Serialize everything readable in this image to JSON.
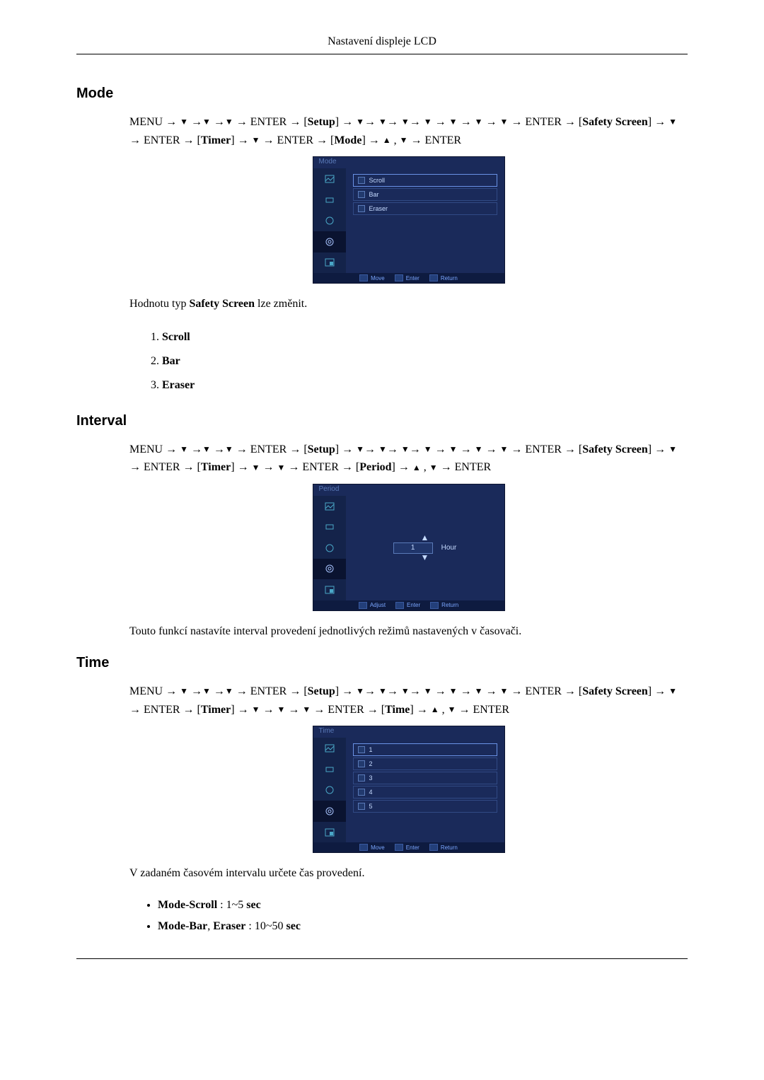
{
  "header": {
    "title": "Nastavení displeje LCD"
  },
  "sections": {
    "mode": {
      "heading": "Mode",
      "nav_a": "MENU → ",
      "nav_setup": "Setup",
      "nav_safety": "Safety Screen",
      "nav_timer": "Timer",
      "nav_mode": "Mode",
      "menu_title": "Mode",
      "options": [
        "Scroll",
        "Bar",
        "Eraser"
      ],
      "footer": {
        "move": "Move",
        "enter": "Enter",
        "return": "Return"
      },
      "text_before": "Hodnotu typ ",
      "text_strong": "Safety Screen",
      "text_after": " lze změnit.",
      "list": [
        "Scroll",
        "Bar",
        "Eraser"
      ]
    },
    "interval": {
      "heading": "Interval",
      "nav_setup": "Setup",
      "nav_safety": "Safety Screen",
      "nav_timer": "Timer",
      "nav_period": "Period",
      "menu_title": "Period",
      "value": "1",
      "unit": "Hour",
      "footer": {
        "adjust": "Adjust",
        "enter": "Enter",
        "return": "Return"
      },
      "text": "Touto funkcí nastavíte interval provedení jednotlivých režimů nastavených v časovači."
    },
    "time": {
      "heading": "Time",
      "nav_setup": "Setup",
      "nav_safety": "Safety Screen",
      "nav_timer": "Timer",
      "nav_time": "Time",
      "menu_title": "Time",
      "options": [
        "1",
        "2",
        "3",
        "4",
        "5"
      ],
      "footer": {
        "move": "Move",
        "enter": "Enter",
        "return": "Return"
      },
      "text": "V zadaném časovém intervalu určete čas provedení.",
      "bullets": {
        "b1_a": "Mode-Scroll",
        "b1_b": " : 1~5 ",
        "b1_c": "sec",
        "b2_a": "Mode-Bar",
        "b2_b": ", ",
        "b2_c": "Eraser",
        "b2_d": " : 10~50 ",
        "b2_e": "sec"
      }
    }
  },
  "glyphs": {
    "arrow": " → ",
    "enter": "ENTER"
  }
}
